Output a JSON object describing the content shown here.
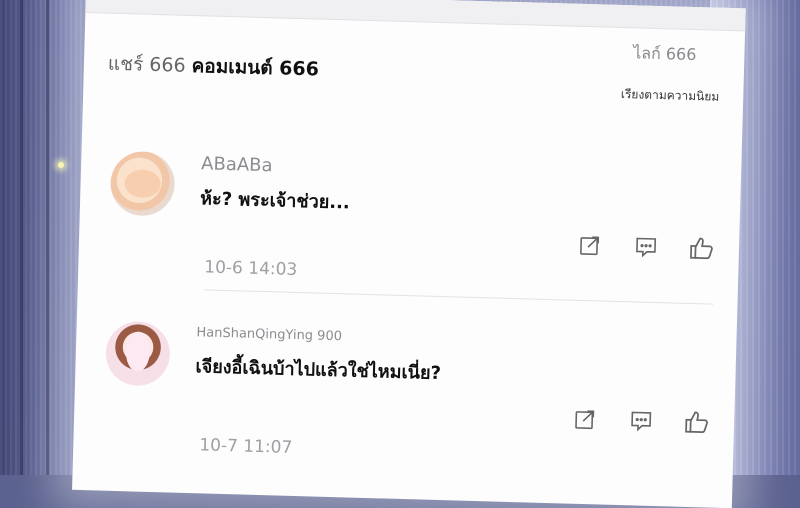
{
  "header": {
    "shares": "แชร์ 666",
    "comments_label": "คอมเมนต์ 666",
    "likes": "ไลก์ 666",
    "sort_label": "เรียงตามความนิยม"
  },
  "comments": [
    {
      "username": "ABaABa",
      "text": "ห้ะ? พระเจ้าช่วย...",
      "time": "10-6 14:03"
    },
    {
      "username": "HanShanQingYing 900",
      "text": "เจียงอี้เฉินบ้าไปแล้วใช่ไหมเนี่ย?",
      "time": "10-7 11:07"
    }
  ],
  "icons": {
    "share": "share-icon",
    "reply": "comment-icon",
    "like": "thumbs-up-icon"
  }
}
